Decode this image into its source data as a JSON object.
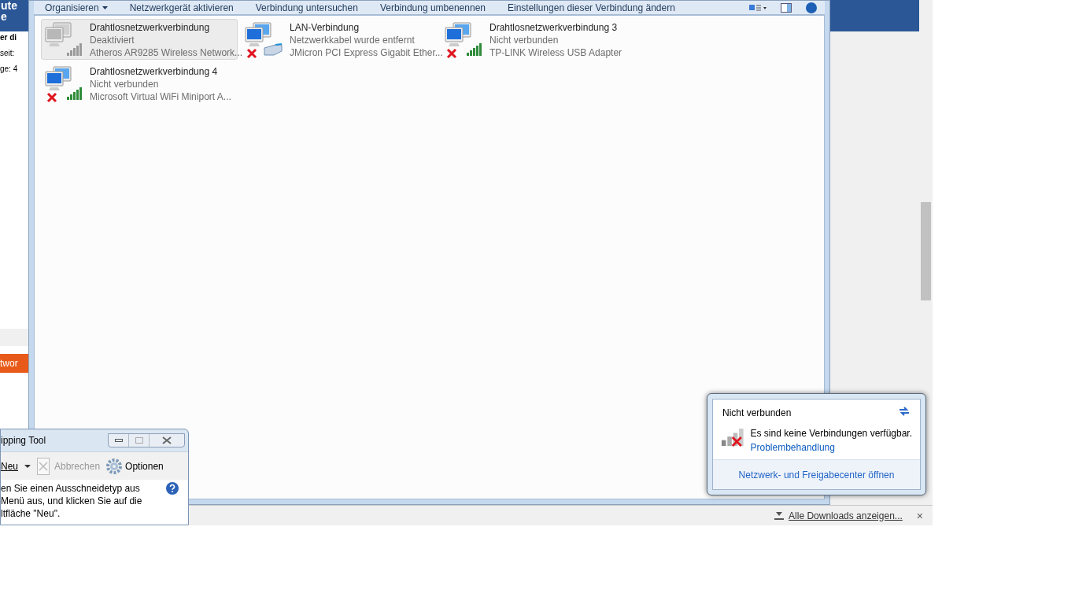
{
  "background_page": {
    "header_texts": [
      "ute",
      "e"
    ],
    "body_texts": [
      "er di",
      "seit:",
      "ge: 4"
    ],
    "orange_tab": "twor"
  },
  "explorer": {
    "toolbar": [
      {
        "label": "Organisieren",
        "dropdown": true
      },
      {
        "label": "Netzwerkgerät aktivieren",
        "dropdown": false
      },
      {
        "label": "Verbindung untersuchen",
        "dropdown": false
      },
      {
        "label": "Verbindung umbenennen",
        "dropdown": false
      },
      {
        "label": "Einstellungen dieser Verbindung ändern",
        "dropdown": false
      }
    ],
    "connections": [
      {
        "name": "Drahtlosnetzwerkverbindung",
        "status": "Deaktiviert",
        "adapter": "Atheros AR9285 Wireless Network...",
        "kind": "wireless",
        "disabled": true,
        "disconnected": false,
        "selected": true
      },
      {
        "name": "LAN-Verbindung",
        "status": "Netzwerkkabel wurde entfernt",
        "adapter": "JMicron PCI Express Gigabit Ether...",
        "kind": "ethernet",
        "disabled": false,
        "disconnected": true,
        "selected": false
      },
      {
        "name": "Drahtlosnetzwerkverbindung 3",
        "status": "Nicht verbunden",
        "adapter": "TP-LINK Wireless USB Adapter",
        "kind": "wireless",
        "disabled": false,
        "disconnected": true,
        "selected": false
      },
      {
        "name": "Drahtlosnetzwerkverbindung 4",
        "status": "Nicht verbunden",
        "adapter": "Microsoft Virtual WiFi Miniport A...",
        "kind": "wireless",
        "disabled": false,
        "disconnected": true,
        "selected": false
      }
    ]
  },
  "snipping_tool": {
    "title": "ipping Tool",
    "new_button": "Neu",
    "cancel_button": "Abbrechen",
    "options_button": "Optionen",
    "hint_lines": [
      "en Sie einen Ausschneidetyp aus",
      "Menü aus, und klicken Sie auf die",
      "ltfläche \"Neu\"."
    ]
  },
  "downloads_bar": {
    "link": "Alle Downloads anzeigen...",
    "close": "×"
  },
  "network_popup": {
    "title": "Nicht verbunden",
    "message": "Es sind keine Verbindungen verfügbar.",
    "link": "Problembehandlung",
    "footer_link": "Netzwerk- und Freigabecenter öffnen"
  }
}
